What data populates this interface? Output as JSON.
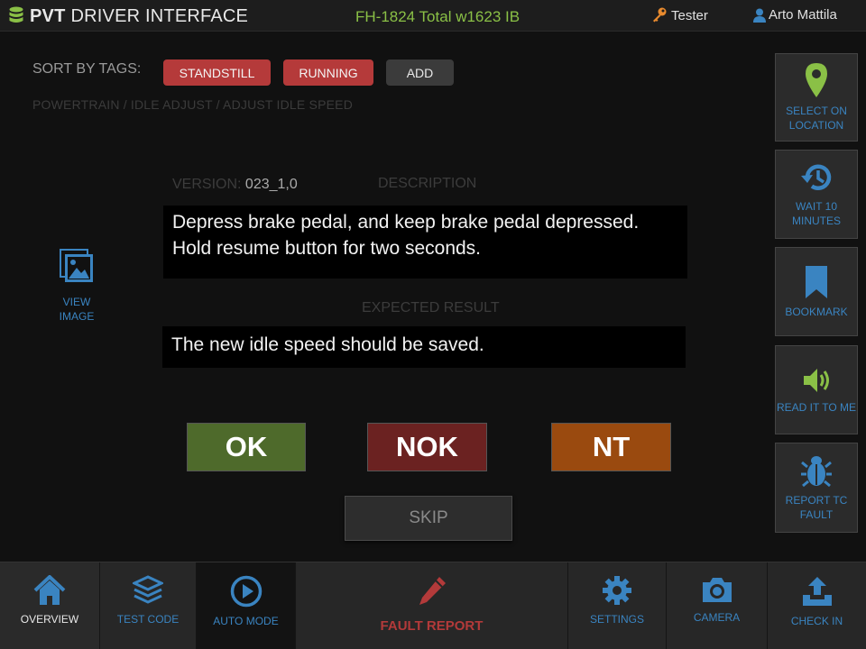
{
  "header": {
    "app_name_bold": "PVT",
    "app_name_rest": "DRIVER INTERFACE",
    "vehicle_info": "FH-1824 Total w1623 IB",
    "role": "Tester",
    "user": "Arto Mattila"
  },
  "tags": {
    "sort_label": "SORT BY TAGS:",
    "items": [
      "STANDSTILL",
      "RUNNING"
    ],
    "add_label": "ADD"
  },
  "breadcrumb": "POWERTRAIN / IDLE ADJUST / ADJUST IDLE SPEED",
  "test": {
    "version_label": "VERSION:",
    "version_value": "023_1,0",
    "description_label": "DESCRIPTION",
    "description": "Depress brake pedal, and keep brake pedal depressed. Hold resume button for two seconds.",
    "expected_label": "EXPECTED RESULT",
    "expected": "The new idle speed should be saved."
  },
  "view_image_label": "VIEW IMAGE",
  "verdicts": {
    "ok": "OK",
    "nok": "NOK",
    "nt": "NT",
    "skip": "SKIP"
  },
  "side_buttons": [
    {
      "label": "SELECT ON LOCATION",
      "icon": "location-pin-icon"
    },
    {
      "label": "WAIT 10 MINUTES",
      "icon": "history-clock-icon"
    },
    {
      "label": "BOOKMARK",
      "icon": "bookmark-icon"
    },
    {
      "label": "READ IT TO ME",
      "icon": "speaker-icon"
    },
    {
      "label": "REPORT TC FAULT",
      "icon": "bug-icon"
    }
  ],
  "bottom_nav": [
    {
      "label": "OVERVIEW",
      "icon": "home-icon"
    },
    {
      "label": "TEST CODE",
      "icon": "layers-icon"
    },
    {
      "label": "AUTO MODE",
      "icon": "play-circle-icon"
    },
    {
      "label": "FAULT REPORT",
      "icon": "pencil-icon"
    },
    {
      "label": "SETTINGS",
      "icon": "gear-icon"
    },
    {
      "label": "CAMERA",
      "icon": "camera-icon"
    },
    {
      "label": "CHECK IN",
      "icon": "upload-icon"
    }
  ],
  "colors": {
    "accent_blue": "#3a84c1",
    "accent_green": "#8ac046",
    "tag_red": "#b53a3a",
    "ok_green": "#4e6a2b",
    "nok_red": "#6b2221",
    "nt_orange": "#9a4a0f"
  }
}
